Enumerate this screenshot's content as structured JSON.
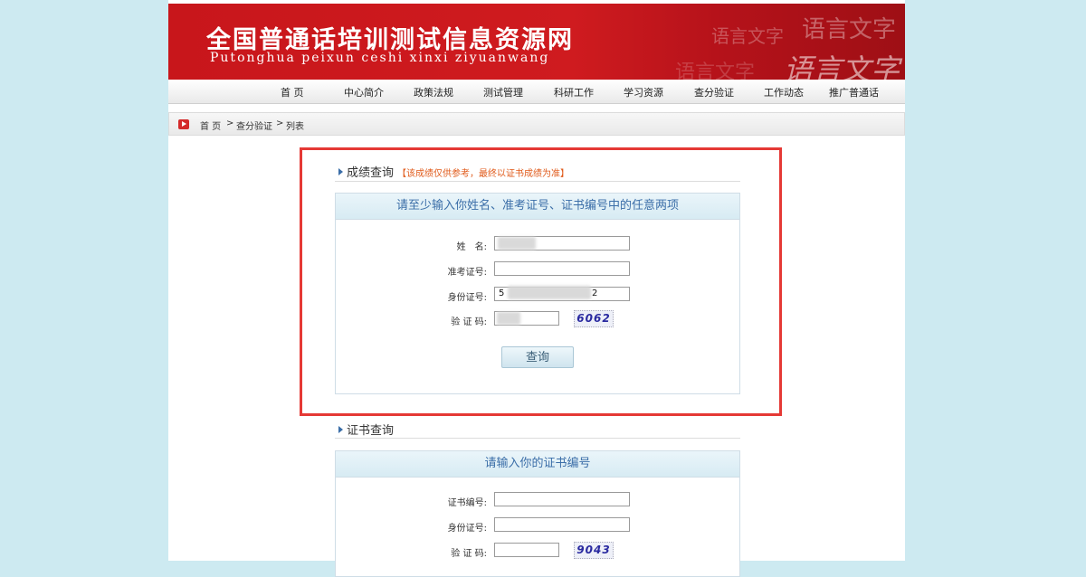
{
  "banner": {
    "title": "全国普通话培训测试信息资源网",
    "subtitle": "Putonghua peixun ceshi xinxi ziyuanwang",
    "deco_1": "语言文字",
    "deco_2": "语言文字",
    "deco_3": "语言文字",
    "deco_4": "语言文字"
  },
  "nav": {
    "items": [
      "首 页",
      "中心简介",
      "政策法规",
      "测试管理",
      "科研工作",
      "学习资源",
      "查分验证",
      "工作动态",
      "推广普通话"
    ]
  },
  "breadcrumb": {
    "home": "首 页",
    "sep1": ">",
    "current_section": "查分验证",
    "sep2": ">",
    "page": "列表"
  },
  "score_query": {
    "title": "成绩查询",
    "note": "【该成绩仅供参考，最终以证书成绩为准】",
    "panel_head": "请至少输入你姓名、准考证号、证书编号中的任意两项",
    "name_label": "姓　名:",
    "name_value": "",
    "exam_no_label": "准考证号:",
    "exam_no_value": "",
    "id_label": "身份证号:",
    "id_value_start": "5",
    "id_value_end": "2",
    "captcha_label": "验 证 码:",
    "captcha_value": "",
    "captcha_image_text": "6062",
    "submit": "查询"
  },
  "cert_query": {
    "title": "证书查询",
    "panel_head": "请输入你的证书编号",
    "cert_no_label": "证书编号:",
    "cert_no_value": "",
    "id_label": "身份证号:",
    "id_value": "",
    "captcha_label": "验 证 码:",
    "captcha_value": "",
    "captcha_image_text": "9043"
  },
  "colors": {
    "banner_red": "#c8161b",
    "highlight_red": "#e53935",
    "panel_blue": "#3b6ea8",
    "note_orange": "#e05a1a",
    "page_bg": "#cdeaf1"
  }
}
